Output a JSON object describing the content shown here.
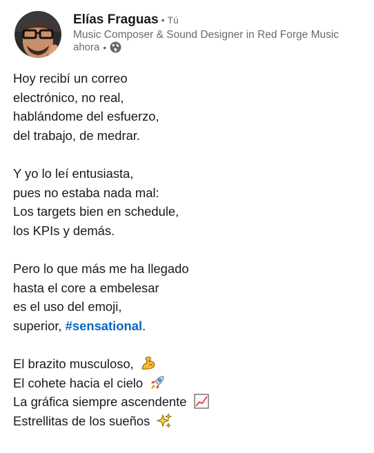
{
  "post": {
    "author": {
      "name": "Elías Fraguas",
      "degree": "Tú",
      "headline": "Music Composer & Sound Designer in Red Forge Music",
      "time": "ahora",
      "visibility_icon": "globe-icon"
    },
    "lines": {
      "l1": "Hoy recibí un correo",
      "l2": "electrónico, no real,",
      "l3": "hablándome del esfuerzo,",
      "l4": "del trabajo, de medrar.",
      "l5": "Y yo lo leí entusiasta,",
      "l6": "pues no estaba nada mal:",
      "l7": "Los targets bien en schedule,",
      "l8": "los KPIs y demás.",
      "l9": "Pero lo que más me ha llegado",
      "l10": "hasta el core a embelesar",
      "l11": "es el uso del emoji,",
      "l12_prefix": "superior, ",
      "l12_hashtag": "#sensational",
      "l12_suffix": ".",
      "l13": "El brazito musculoso,",
      "l14": "El cohete hacia el cielo",
      "l15": "La gráfica siempre ascendente",
      "l16": "Estrellitas de los sueños"
    },
    "emojis": {
      "e13": "flexed-biceps-icon",
      "e14": "rocket-icon",
      "e15": "chart-increasing-icon",
      "e16": "sparkles-icon"
    },
    "colors": {
      "hashtag": "#0a66c2",
      "text": "rgba(0,0,0,0.9)",
      "secondary": "rgba(0,0,0,0.6)"
    }
  }
}
